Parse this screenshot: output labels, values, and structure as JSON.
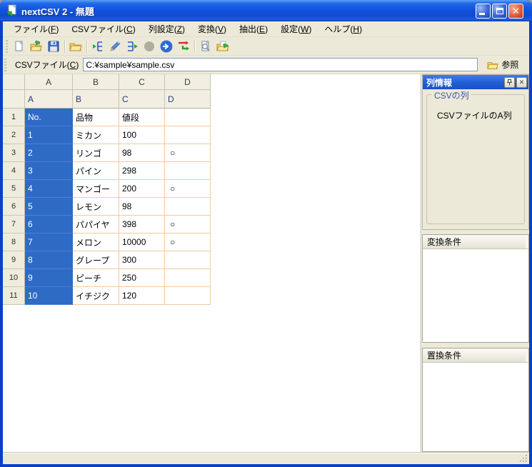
{
  "window": {
    "title": "nextCSV 2 - 無題"
  },
  "menu": {
    "items": [
      {
        "label": "ファイル(F)"
      },
      {
        "label": "CSVファイル(C)"
      },
      {
        "label": "列設定(Z)"
      },
      {
        "label": "変換(V)"
      },
      {
        "label": "抽出(E)"
      },
      {
        "label": "設定(W)"
      },
      {
        "label": "ヘルプ(H)"
      }
    ]
  },
  "toolbar": {
    "icon_names": [
      "new-file-icon",
      "open-file-icon",
      "save-icon",
      "folder-icon",
      "insert-column-icon",
      "edit-pencil-icon",
      "output-column-icon",
      "record-circle-icon",
      "run-icon",
      "convert-icon",
      "preview-icon",
      "export-folder-icon"
    ]
  },
  "filebar": {
    "label": "CSVファイル(C)",
    "path": "C:¥sample¥sample.csv",
    "browse": "参照"
  },
  "table": {
    "column_letters": [
      "A",
      "B",
      "C",
      "D"
    ],
    "csv_column_names": [
      "A",
      "B",
      "C",
      "D"
    ],
    "selected_column_index": 0,
    "rows": [
      [
        "No.",
        "品物",
        "値段",
        ""
      ],
      [
        "1",
        "ミカン",
        "100",
        ""
      ],
      [
        "2",
        "リンゴ",
        "98",
        "○"
      ],
      [
        "3",
        "パイン",
        "298",
        ""
      ],
      [
        "4",
        "マンゴー",
        "200",
        "○"
      ],
      [
        "5",
        "レモン",
        "98",
        ""
      ],
      [
        "6",
        "パパイヤ",
        "398",
        "○"
      ],
      [
        "7",
        "メロン",
        "10000",
        "○"
      ],
      [
        "8",
        "グレープ",
        "300",
        ""
      ],
      [
        "9",
        "ピーチ",
        "250",
        ""
      ],
      [
        "10",
        "イチジク",
        "120",
        ""
      ]
    ]
  },
  "panel": {
    "title": "列情報",
    "groupbox_title": "CSVの列",
    "groupbox_content": "CSVファイルのA列",
    "sections": [
      {
        "header": "変換条件"
      },
      {
        "header": "置換条件"
      }
    ]
  },
  "colors": {
    "selection_blue": "#2E6BC5",
    "grid_line_peach": "#F3C9A2",
    "chrome_beige": "#ECE9D8",
    "titlebar_blue": "#1355E0",
    "panel_header_blue": "#2260D8"
  }
}
